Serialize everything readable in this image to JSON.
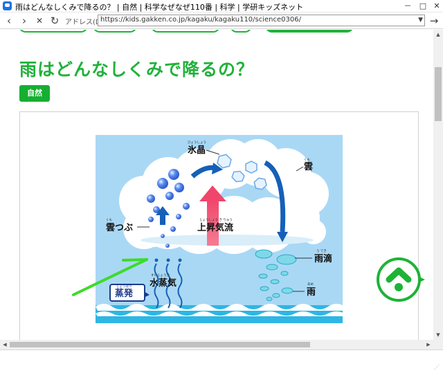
{
  "window": {
    "title": "雨はどんなしくみで降るの？ | 自然 | 科学なぜなぜ110番 | 科学 | 学研キッズネット",
    "minimize": "－",
    "maximize": "□",
    "close": "✕"
  },
  "nav": {
    "back": "‹",
    "forward": "›",
    "stop": "✕",
    "reload": "↻",
    "address_label": "アドレス(D)",
    "url": "https://kids.gakken.co.jp/kagaku/kagaku110/science0306/",
    "go": "→"
  },
  "page": {
    "title": "雨はどんなしくみで降るの？",
    "tag": "自然"
  },
  "illustration": {
    "labels": {
      "ice_crystal": "氷晶",
      "ice_crystal_ruby": "ひょうしょう",
      "cloud": "雲",
      "cloud_ruby": "くも",
      "cloud_droplet": "雲つぶ",
      "cloud_droplet_ruby": "くも",
      "updraft": "上昇気流",
      "updraft_ruby": "じょうしょう き りゅう",
      "raindrop": "雨滴",
      "raindrop_ruby": "う てき",
      "vapor": "水蒸気",
      "vapor_ruby": "すいじょうき",
      "evaporation": "蒸発",
      "evaporation_ruby": "じょうはつ",
      "rain": "雨",
      "rain_ruby": "あめ"
    },
    "colors": {
      "sky": "#a9d8f5",
      "sea": "#30b8e6",
      "arrow_blue": "#1560b8",
      "arrow_red": "#f0466b",
      "pointer_green": "#3ddb2a"
    }
  },
  "status": {
    "text": ""
  },
  "colors": {
    "brand_green": "#1db336"
  }
}
